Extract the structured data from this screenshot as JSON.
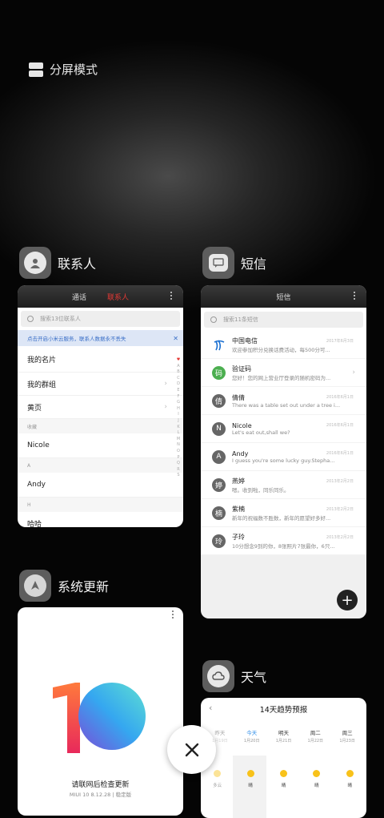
{
  "split_screen": {
    "label": "分屏模式"
  },
  "apps": {
    "contacts": {
      "name": "联系人",
      "tabs": [
        "通话",
        "联系人"
      ],
      "search_placeholder": "搜索13位联系人",
      "banner": "点击开启小米云服务，联系人数据永不丢失",
      "rows": [
        "我的名片",
        "我的群组",
        "黄页"
      ],
      "section_favorites": "收藏",
      "favorite": "Nicole",
      "section_a": "A",
      "contact_a": "Andy",
      "section_h": "H",
      "contact_h": "哈哈",
      "alphabet": [
        "♥",
        "A",
        "B",
        "C",
        "D",
        "E",
        "F",
        "G",
        "H",
        "I",
        "J",
        "K",
        "L",
        "M",
        "N",
        "O",
        "P",
        "Q",
        "R",
        "S"
      ]
    },
    "sms": {
      "name": "短信",
      "title": "短信",
      "search_placeholder": "搜索11条短信",
      "messages": [
        {
          "avatar": "",
          "name": "中国电信",
          "preview": "欢迎参加积分兑换话费活动，每500分可...",
          "date": "2017年6月3日"
        },
        {
          "avatar": "码",
          "name": "验证码",
          "preview": "您好！您的网上营业厅登录的随机密码为...",
          "date": ""
        },
        {
          "avatar": "倩",
          "name": "倩倩",
          "preview": "There was a table set out under a tree i...",
          "date": "2016年6月1日"
        },
        {
          "avatar": "N",
          "name": "Nicole",
          "preview": "Let's eat out,shall we?",
          "date": "2016年6月1日"
        },
        {
          "avatar": "A",
          "name": "Andy",
          "preview": "I guess you're some lucky guy.Stepha...",
          "date": "2016年6月1日"
        },
        {
          "avatar": "婷",
          "name": "燕婷",
          "preview": "嗯。收到啦，同乐同乐。",
          "date": "2013年2月2日"
        },
        {
          "avatar": "楠",
          "name": "紫楠",
          "preview": "新年的祝福数不胜数，新年的愿望好多好...",
          "date": "2013年2月2日"
        },
        {
          "avatar": "玲",
          "name": "子玲",
          "preview": "10分想念9到的你，8张照片7张最你，6只...",
          "date": "2013年2月2日"
        }
      ]
    },
    "updater": {
      "name": "系统更新",
      "message": "请联网后检查更新",
      "version": "MIUI 10 8.12.28 | 稳定版"
    },
    "weather": {
      "name": "天气",
      "title": "14天趋势预报",
      "days": [
        {
          "day": "昨天",
          "date": "1月19日",
          "cond": "多云"
        },
        {
          "day": "今天",
          "date": "1月20日",
          "cond": "晴"
        },
        {
          "day": "明天",
          "date": "1月21日",
          "cond": "晴"
        },
        {
          "day": "周二",
          "date": "1月22日",
          "cond": "晴"
        },
        {
          "day": "周三",
          "date": "1月23日",
          "cond": "晴"
        }
      ]
    }
  },
  "colors": {
    "accent_red": "#e53935",
    "today_blue": "#2b8ce8",
    "sun_yellow": "#f8c21a"
  }
}
